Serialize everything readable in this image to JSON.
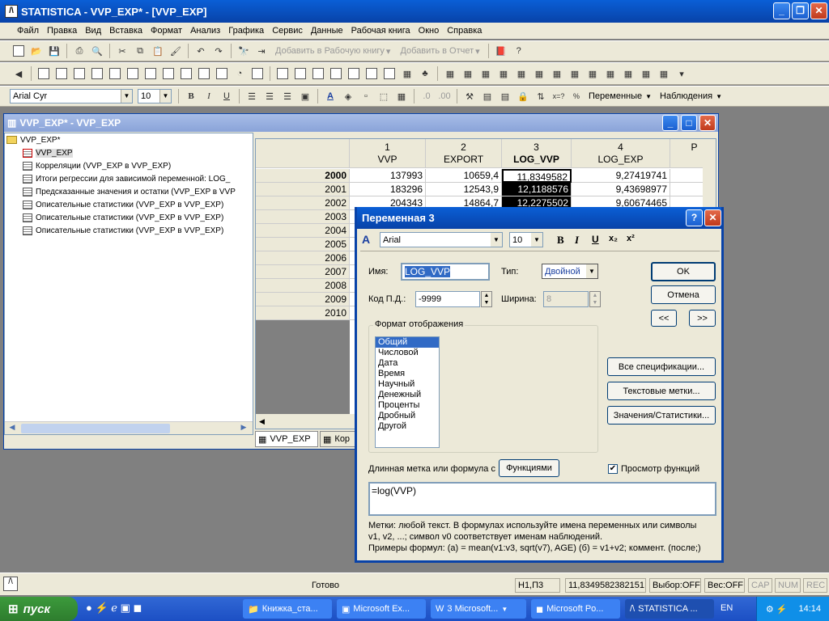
{
  "app": {
    "title": "STATISTICA - VVP_EXP* - [VVP_EXP]"
  },
  "menu": [
    "Файл",
    "Правка",
    "Вид",
    "Вставка",
    "Формат",
    "Анализ",
    "Графика",
    "Сервис",
    "Данные",
    "Рабочая книга",
    "Окно",
    "Справка"
  ],
  "toolbar1": {
    "add_workbook": "Добавить в Рабочую книгу",
    "add_report": "Добавить в Отчет"
  },
  "toolbar3": {
    "font": "Arial Cyr",
    "size": "10",
    "observations_label": "Переменные",
    "cases_label": "Наблюдения"
  },
  "workbook": {
    "title": "VVP_EXP* - VVP_EXP",
    "tree_root": "VVP_EXP*",
    "tree_items": [
      "VVP_EXP",
      "Корреляции (VVP_EXP в VVP_EXP)",
      "Итоги регрессии для зависимой переменной: LOG_",
      "Предсказанные значения и остатки (VVP_EXP в VVP",
      "Описательные статистики (VVP_EXP в VVP_EXP)",
      "Описательные статистики (VVP_EXP в VVP_EXP)",
      "Описательные статистики (VVP_EXP в VVP_EXP)"
    ],
    "tabs": [
      "VVP_EXP",
      "Кор"
    ]
  },
  "grid": {
    "columns": [
      {
        "num": "1",
        "name": "VVP"
      },
      {
        "num": "2",
        "name": "EXPORT"
      },
      {
        "num": "3",
        "name": "LOG_VVP"
      },
      {
        "num": "4",
        "name": "LOG_EXP"
      },
      {
        "num": "",
        "name": "P"
      }
    ],
    "rows": [
      {
        "year": "2000",
        "vals": [
          "137993",
          "10659,4",
          "11,8349582",
          "9,27419741"
        ]
      },
      {
        "year": "2001",
        "vals": [
          "183296",
          "12543,9",
          "12,1188576",
          "9,43698977"
        ]
      },
      {
        "year": "2002",
        "vals": [
          "204343",
          "14864,7",
          "12,2275502",
          "9,60674465"
        ]
      },
      {
        "year": "2003",
        "vals": [
          "",
          "",
          "",
          ""
        ]
      },
      {
        "year": "2004",
        "vals": [
          "",
          "",
          "",
          ""
        ]
      },
      {
        "year": "2005",
        "vals": [
          "",
          "",
          "",
          ""
        ]
      },
      {
        "year": "2006",
        "vals": [
          "",
          "",
          "",
          ""
        ]
      },
      {
        "year": "2007",
        "vals": [
          "",
          "",
          "",
          ""
        ]
      },
      {
        "year": "2008",
        "vals": [
          "",
          "",
          "",
          ""
        ]
      },
      {
        "year": "2009",
        "vals": [
          "",
          "",
          "",
          ""
        ]
      },
      {
        "year": "2010",
        "vals": [
          "",
          "",
          "",
          ""
        ]
      }
    ]
  },
  "dialog": {
    "title": "Переменная 3",
    "font": "Arial",
    "size": "10",
    "name_label": "Имя:",
    "name_value": "LOG_VVP",
    "type_label": "Тип:",
    "type_value": "Двойной",
    "md_label": "Код П.Д.:",
    "md_value": "-9999",
    "width_label": "Ширина:",
    "width_value": "8",
    "format_group": "Формат отображения",
    "formats": [
      "Общий",
      "Числовой",
      "Дата",
      "Время",
      "Научный",
      "Денежный",
      "Проценты",
      "Дробный",
      "Другой"
    ],
    "ok": "OK",
    "cancel": "Отмена",
    "prev": "<<",
    "next": ">>",
    "all_specs": "Все спецификации...",
    "text_labels": "Текстовые метки...",
    "values_stats": "Значения/Статистики...",
    "long_label": "Длинная метка или формула с",
    "functions": "Функциями",
    "preview_label": "Просмотр функций",
    "formula": "=log(VVP)",
    "help1": "Метки: любой текст.    В формулах используйте имена переменных или символы",
    "help2": "v1, v2, ...; символ v0 соответствует именам наблюдений.",
    "help3": "Примеры формул:   (a) = mean(v1:v3, sqrt(v7), AGE)   (б) = v1+v2; коммент. (после;)"
  },
  "status": {
    "ready": "Готово",
    "cell": "H1,П3",
    "value": "11,8349582382151",
    "selection": "Выбор:OFF",
    "weight": "Вес:OFF",
    "cap": "CAP",
    "num": "NUM",
    "rec": "REC"
  },
  "taskbar": {
    "start": "пуск",
    "tasks": [
      "Книжка_ста...",
      "Microsoft Ex...",
      "3 Microsoft...",
      "Microsoft Po...",
      "STATISTICA ..."
    ],
    "lang": "EN",
    "time": "14:14"
  }
}
